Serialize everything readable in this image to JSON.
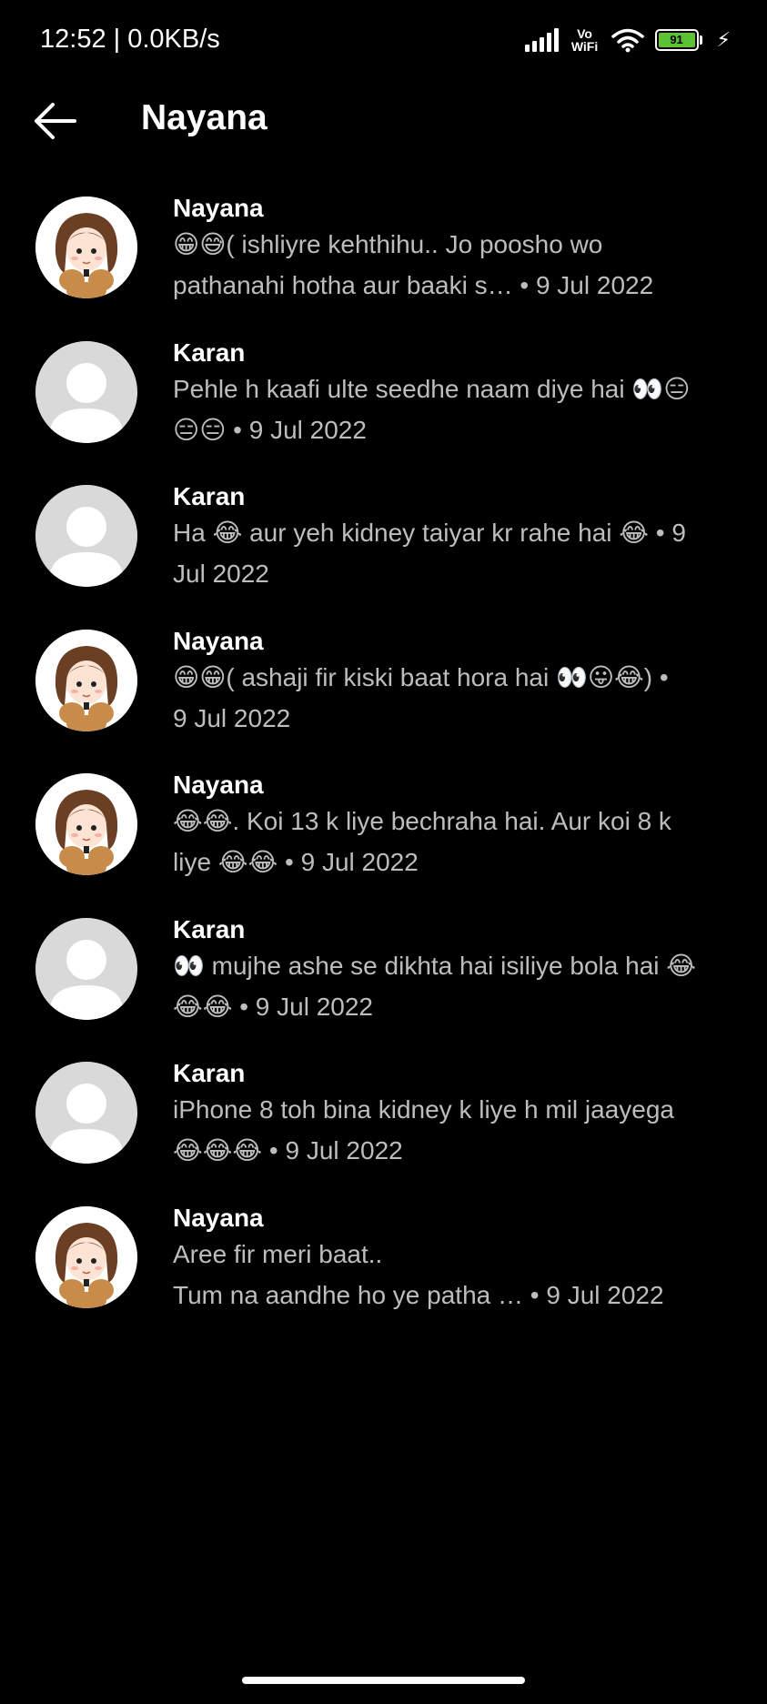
{
  "status_bar": {
    "time": "12:52 | 0.0KB/s",
    "vowifi": "Vo WiFi",
    "battery": "91",
    "icons": [
      "signal-icon",
      "vowifi-icon",
      "wifi-icon",
      "battery-icon",
      "charging-icon"
    ]
  },
  "header": {
    "back_icon": "back-arrow-icon",
    "title": "Nayana"
  },
  "messages": [
    {
      "sender": "Nayana",
      "avatar": "girl",
      "line1": "😁😅( ishliyre kehthihu.. Jo poosho wo",
      "line2": "pathanahi hotha aur baaki s… • 9 Jul 2022"
    },
    {
      "sender": "Karan",
      "avatar": "blank",
      "line1": "Pehle h kaafi ulte seedhe naam diye hai 👀😑",
      "line2": "😑😑 • 9 Jul 2022"
    },
    {
      "sender": "Karan",
      "avatar": "blank",
      "line1": "Ha 😂 aur yeh kidney taiyar kr rahe hai 😂 • 9",
      "line2": "Jul 2022"
    },
    {
      "sender": "Nayana",
      "avatar": "girl",
      "line1": "😁😁( ashaji fir kiski baat hora hai 👀😛😂) •",
      "line2": "9 Jul 2022"
    },
    {
      "sender": "Nayana",
      "avatar": "girl",
      "line1": "😂😂. Koi 13 k liye bechraha hai. Aur koi 8 k",
      "line2": "liye 😂😂 • 9 Jul 2022"
    },
    {
      "sender": "Karan",
      "avatar": "blank",
      "line1": "👀 mujhe ashe se dikhta hai isiliye bola hai 😂",
      "line2": "😂😂 • 9 Jul 2022"
    },
    {
      "sender": "Karan",
      "avatar": "blank",
      "line1": "iPhone 8 toh bina kidney k liye h mil jaayega",
      "line2": "😂😂😂 • 9 Jul 2022"
    },
    {
      "sender": "Nayana",
      "avatar": "girl",
      "line1": "Aree fir meri baat..",
      "line2": "Tum na aandhe ho ye patha … • 9 Jul 2022"
    }
  ]
}
